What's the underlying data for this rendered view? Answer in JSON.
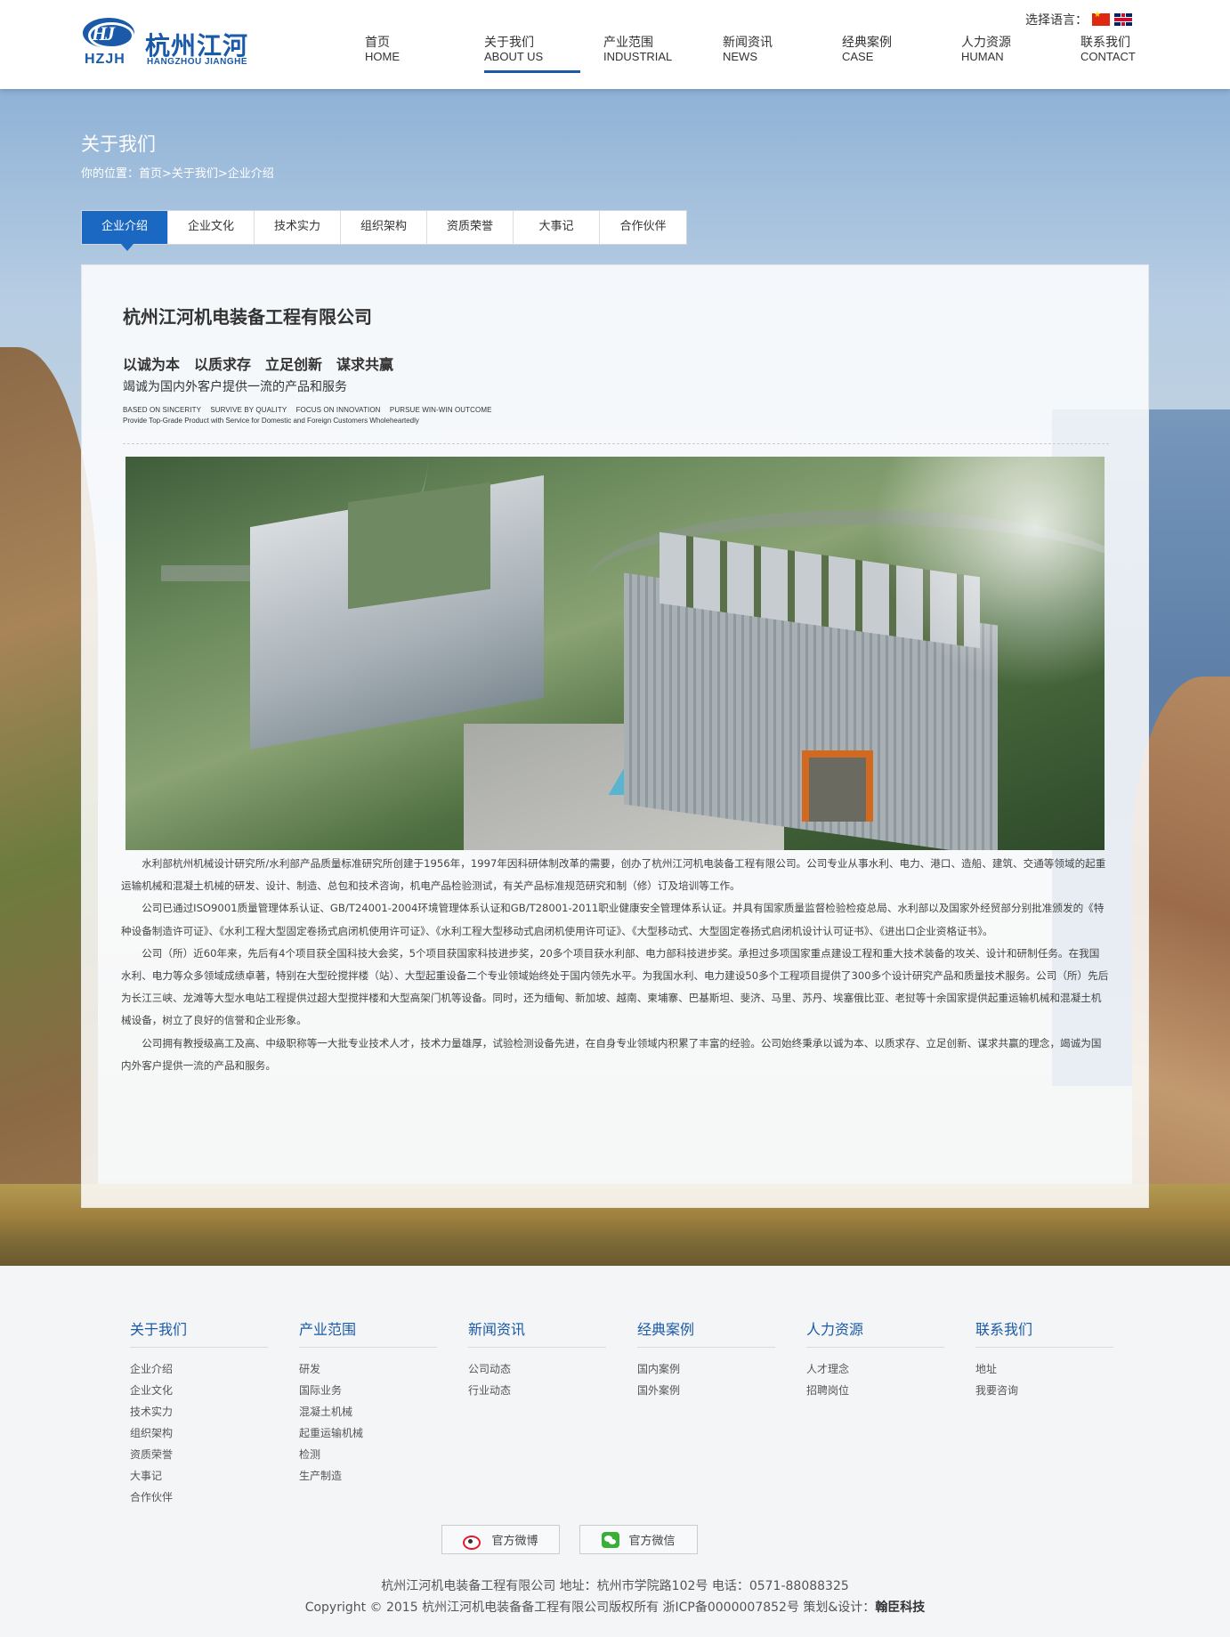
{
  "header": {
    "logo_mark": "HJ",
    "logo_abbr": "HZJH",
    "logo_cn": "杭州江河",
    "logo_en": "HANGZHOU JIANGHE",
    "language_label": "选择语言："
  },
  "nav": [
    {
      "cn": "首页",
      "en": "HOME"
    },
    {
      "cn": "关于我们",
      "en": "ABOUT US"
    },
    {
      "cn": "产业范围",
      "en": "INDUSTRIAL"
    },
    {
      "cn": "新闻资讯",
      "en": "NEWS"
    },
    {
      "cn": "经典案例",
      "en": "CASE"
    },
    {
      "cn": "人力资源",
      "en": "HUMAN"
    },
    {
      "cn": "联系我们",
      "en": "CONTACT"
    }
  ],
  "page": {
    "title": "关于我们",
    "breadcrumb": "你的位置：首页>关于我们>企业介绍"
  },
  "subtabs": [
    "企业介绍",
    "企业文化",
    "技术实力",
    "组织架构",
    "资质荣誉",
    "大事记",
    "合作伙伴"
  ],
  "content": {
    "company_title": "杭州江河机电装备工程有限公司",
    "slogan": "以诚为本　以质求存　立足创新　谋求共赢",
    "slogan_sub": "竭诚为国内外客户提供一流的产品和服务",
    "slogan_en": "BASED ON SINCERITY　 SURVIVE BY QUALITY　 FOCUS ON INNOVATION　 PURSUE WIN-WIN OUTCOME",
    "slogan_en2": "Provide Top-Grade Product with Service for Domestic and Foreign Customers Wholeheartedly",
    "paragraphs": [
      "水利部杭州机械设计研究所/水利部产品质量标准研究所创建于1956年，1997年因科研体制改革的需要，创办了杭州江河机电装备工程有限公司。公司专业从事水利、电力、港口、造船、建筑、交通等领域的起重运输机械和混凝土机械的研发、设计、制造、总包和技术咨询，机电产品检验测试，有关产品标准规范研究和制（修）订及培训等工作。",
      "公司已通过ISO9001质量管理体系认证、GB/T24001-2004环境管理体系认证和GB/T28001-2011职业健康安全管理体系认证。并具有国家质量监督检验检疫总局、水利部以及国家外经贸部分别批准颁发的《特种设备制造许可证》、《水利工程大型固定卷扬式启闭机使用许可证》、《水利工程大型移动式启闭机使用许可证》、《大型移动式、大型固定卷扬式启闭机设计认可证书》、《进出口企业资格证书》。",
      "公司（所）近60年来，先后有4个项目获全国科技大会奖，5个项目获国家科技进步奖，20多个项目获水利部、电力部科技进步奖。承担过多项国家重点建设工程和重大技术装备的攻关、设计和研制任务。在我国水利、电力等众多领域成绩卓著，特别在大型砼搅拌楼（站）、大型起重设备二个专业领域始终处于国内领先水平。为我国水利、电力建设50多个工程项目提供了300多个设计研究产品和质量技术服务。公司（所）先后为长江三峡、龙滩等大型水电站工程提供过超大型搅拌楼和大型高架门机等设备。同时，还为缅甸、新加坡、越南、柬埔寨、巴基斯坦、斐济、马里、苏丹、埃塞俄比亚、老挝等十余国家提供起重运输机械和混凝土机械设备，树立了良好的信誉和企业形象。",
      "公司拥有教授级高工及高、中级职称等一大批专业技术人才，技术力量雄厚，试验检测设备先进，在自身专业领域内积累了丰富的经验。公司始终秉承以诚为本、以质求存、立足创新、谋求共赢的理念，竭诚为国内外客户提供一流的产品和服务。"
    ]
  },
  "footer": {
    "columns": [
      {
        "title": "关于我们",
        "links": [
          "企业介绍",
          "企业文化",
          "技术实力",
          "组织架构",
          "资质荣誉",
          "大事记",
          "合作伙伴"
        ]
      },
      {
        "title": "产业范围",
        "links": [
          "研发",
          "国际业务",
          "混凝土机械",
          "起重运输机械",
          "检测",
          "生产制造"
        ]
      },
      {
        "title": "新闻资讯",
        "links": [
          "公司动态",
          "行业动态"
        ]
      },
      {
        "title": "经典案例",
        "links": [
          "国内案例",
          "国外案例"
        ]
      },
      {
        "title": "人力资源",
        "links": [
          "人才理念",
          "招聘岗位"
        ]
      },
      {
        "title": "联系我们",
        "links": [
          "地址",
          "我要咨询"
        ]
      }
    ],
    "weibo_label": "官方微博",
    "wechat_label": "官方微信",
    "info": "杭州江河机电装备工程有限公司 地址：杭州市学院路102号 电话：0571-88088325",
    "copyright": "Copyright © 2015 杭州江河机电装备备工程有限公司版权所有 浙ICP备0000007852号 策划&设计：",
    "designer": "翰臣科技"
  },
  "colors": {
    "brand": "#1a5aa8",
    "tab_active": "#1a68c1"
  }
}
